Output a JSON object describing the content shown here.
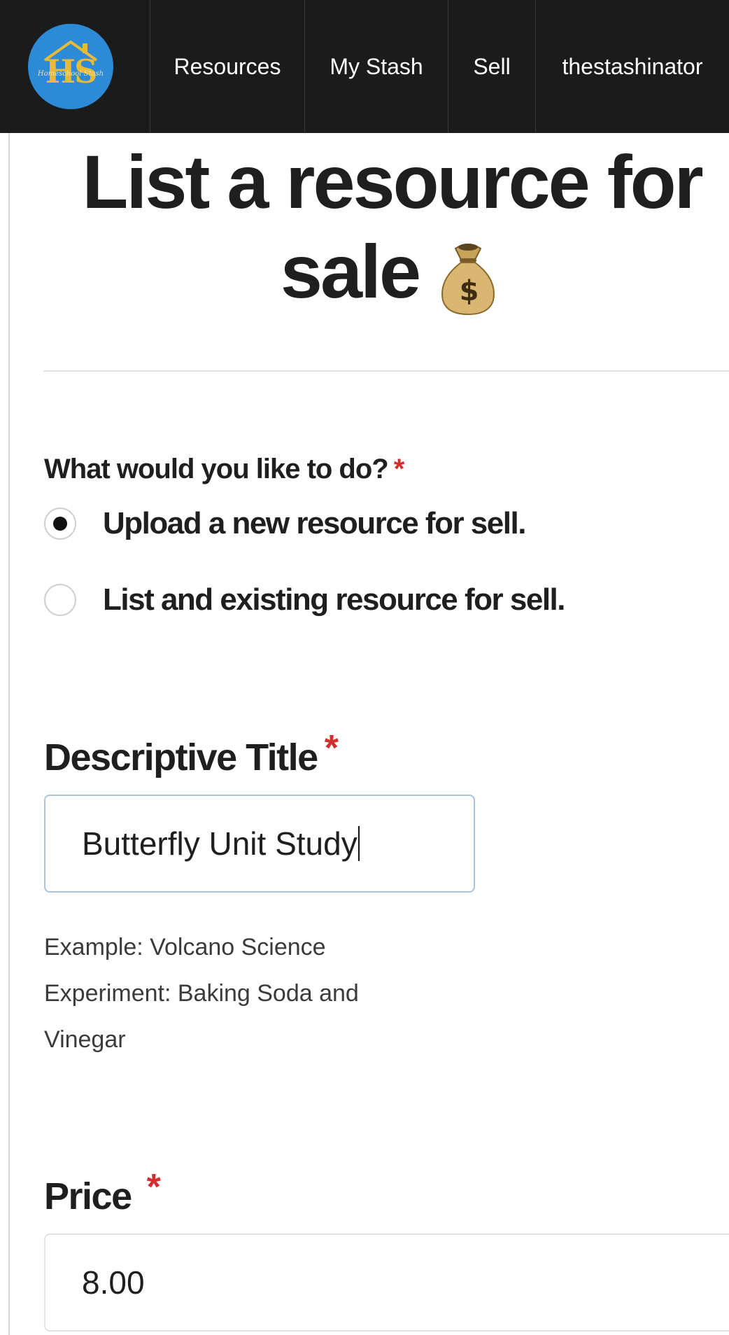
{
  "navbar": {
    "logo": {
      "letters": "HS",
      "script": "Homeschool Stash",
      "icon": "house-roof-icon"
    },
    "items": [
      "Resources",
      "My Stash",
      "Sell",
      "thestashinator"
    ]
  },
  "page": {
    "title_line1": "List a resource for",
    "title_line2": "sale",
    "title_icon": "money-bag-icon"
  },
  "form": {
    "question": "What would you like to do?",
    "required_mark": "*",
    "options": [
      {
        "label": "Upload a new resource for sell.",
        "selected": true
      },
      {
        "label": "List and existing resource for sell.",
        "selected": false
      }
    ],
    "title_field": {
      "label": "Descriptive Title",
      "value": "Butterfly Unit Study",
      "helper_lines": [
        "Example: Volcano Science",
        "Experiment: Baking Soda and",
        "Vinegar"
      ]
    },
    "price_field": {
      "label": "Price",
      "value": "8.00"
    }
  },
  "colors": {
    "navbar_bg": "#1b1b1b",
    "logo_bg": "#2c8ad6",
    "logo_gold": "#e9b93a",
    "required_red": "#d32f2f",
    "input_focus_border": "#a9c4dd"
  }
}
